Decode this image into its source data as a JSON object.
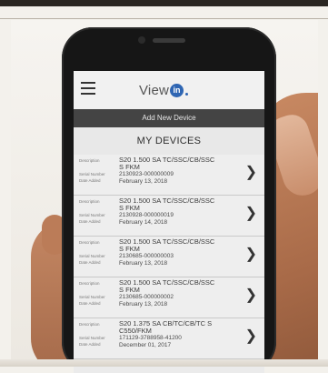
{
  "app": {
    "logo_text": "View",
    "logo_badge": "in",
    "add_device_label": "Add New Device",
    "section_title": "MY DEVICES",
    "labels": {
      "description": "Description",
      "serial": "Serial Number",
      "date": "Date Added"
    }
  },
  "devices": [
    {
      "desc1": "S20 1.500 SA TC/SSC/CB/SSC",
      "desc2": "S FKM",
      "serial": "2130923-000000009",
      "date": "February 13, 2018"
    },
    {
      "desc1": "S20 1.500 SA TC/SSC/CB/SSC",
      "desc2": "S FKM",
      "serial": "2130928-000000019",
      "date": "February 14, 2018"
    },
    {
      "desc1": "S20 1.500 SA TC/SSC/CB/SSC",
      "desc2": "S FKM",
      "serial": "2130685-000000003",
      "date": "February 13, 2018"
    },
    {
      "desc1": "S20 1.500 SA TC/SSC/CB/SSC",
      "desc2": "S FKM",
      "serial": "2130685-000000002",
      "date": "February 13, 2018"
    },
    {
      "desc1": "S20 1.375 SA CB/TC/CB/TC S",
      "desc2": "C550/FKM",
      "serial": "171129-3788958-41200",
      "date": "December 01, 2017"
    }
  ]
}
